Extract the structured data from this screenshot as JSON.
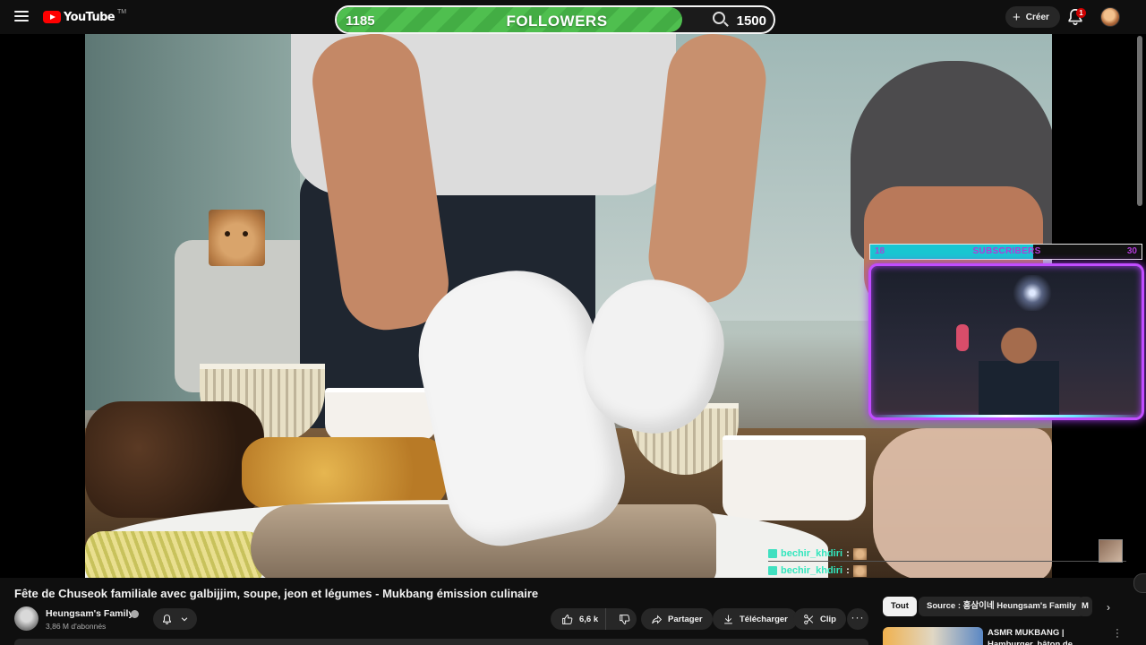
{
  "header": {
    "logo_text": "YouTube",
    "logo_tm": "TM",
    "create_label": "Créer",
    "notifications_count": "1"
  },
  "overlays": {
    "followers": {
      "current": "1185",
      "label": "FOLLOWERS",
      "goal": "1500",
      "progress": 0.79,
      "color": "#4fbf4f"
    },
    "subscribers": {
      "current": "18",
      "label": "SUBSCRIBERS",
      "goal": "30",
      "progress": 0.6,
      "color": "#19c6d1"
    },
    "chat": [
      {
        "user": "bechir_khdiri",
        "sep": ":"
      },
      {
        "user": "bechir_khdiri",
        "sep": ":"
      }
    ]
  },
  "video": {
    "title": "Fête de Chuseok familiale avec galbijjim, soupe, jeon et légumes - Mukbang émission culinaire",
    "channel_name": "Heungsam's Family",
    "subscribers": "3,86 M d'abonnés",
    "likes": "6,6 k",
    "share_label": "Partager",
    "download_label": "Télécharger",
    "clip_label": "Clip"
  },
  "sidebar": {
    "chips": {
      "all": "Tout",
      "source": "Source : 흥삼이네 Heungsam's Family",
      "more": "M"
    },
    "recommendation": {
      "title": "ASMR MUKBANG | Hamburger, bâton de fromage, Nouilles au"
    }
  },
  "icons": [
    "menu-icon",
    "youtube-logo-icon",
    "search-icon",
    "plus-icon",
    "bell-icon",
    "avatar",
    "verified-icon",
    "thumbs-up-icon",
    "thumbs-down-icon",
    "share-icon",
    "download-icon",
    "scissors-icon",
    "more-icon",
    "chevron-right-icon"
  ]
}
